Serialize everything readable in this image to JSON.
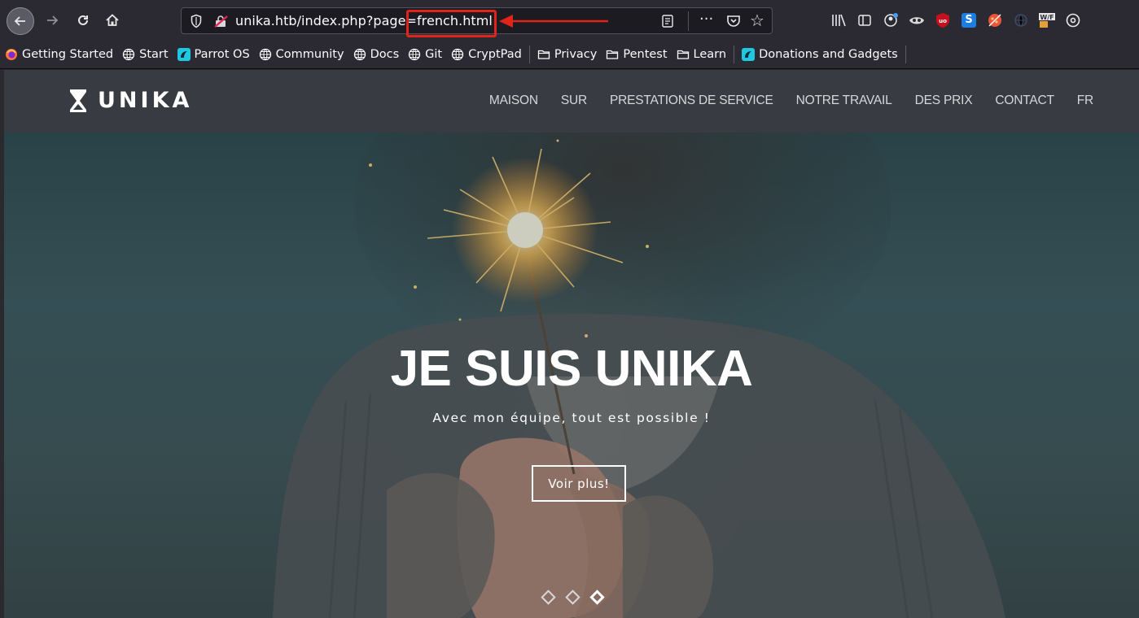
{
  "browser": {
    "url_prefix": "unika.htb/index.php?page=",
    "url_highlight": "french.html",
    "bookmarks": [
      {
        "label": "Getting Started"
      },
      {
        "label": "Start"
      },
      {
        "label": "Parrot OS"
      },
      {
        "label": "Community"
      },
      {
        "label": "Docs"
      },
      {
        "label": "Git"
      },
      {
        "label": "CryptPad"
      },
      {
        "label": "Privacy"
      },
      {
        "label": "Pentest"
      },
      {
        "label": "Learn"
      },
      {
        "label": "Donations and Gadgets"
      }
    ],
    "colors": {
      "highlight": "#e0241a",
      "toolbar": "#2b2a33"
    }
  },
  "site": {
    "logo_text": "UNIKA",
    "nav": [
      "MAISON",
      "SUR",
      "PRESTATIONS DE SERVICE",
      "NOTRE TRAVAIL",
      "DES PRIX",
      "CONTACT",
      "FR"
    ],
    "hero": {
      "title": "JE SUIS UNIKA",
      "subtitle": "Avec mon équipe, tout est possible !",
      "button": "Voir plus!",
      "slides": 3,
      "active_slide": 3
    }
  }
}
